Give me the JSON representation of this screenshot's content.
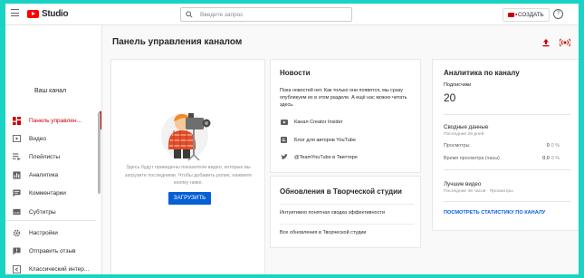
{
  "topbar": {
    "logo_text": "Studio",
    "search_placeholder": "Введите запрос",
    "create_label": "СОЗДАТЬ",
    "help_glyph": "?"
  },
  "sidebar": {
    "channel_label": "Ваш канал",
    "items": [
      {
        "label": "Панель управлен...",
        "icon": "dashboard-icon",
        "active": true
      },
      {
        "label": "Видео",
        "icon": "video-icon"
      },
      {
        "label": "Плейлисты",
        "icon": "playlist-icon"
      },
      {
        "label": "Аналитика",
        "icon": "analytics-icon"
      },
      {
        "label": "Комментарии",
        "icon": "comments-icon"
      },
      {
        "label": "Субтитры",
        "icon": "subtitles-icon"
      },
      {
        "label": "Настройки",
        "icon": "gear-icon"
      },
      {
        "label": "Отправить отзыв",
        "icon": "feedback-icon"
      },
      {
        "label": "Классический интер...",
        "icon": "classic-icon"
      }
    ]
  },
  "main": {
    "title": "Панель управления каналом",
    "upload_card": {
      "text": "Здесь будут приведены показатели видео, которые вы загрузите последними. Чтобы добавить ролик, нажмите кнопку ниже.",
      "button": "ЗАГРУЗИТЬ"
    },
    "news": {
      "title": "Новости",
      "text": "Пока новостей нет. Как только они появятся, мы сразу опубликуем их в этом разделе. А ещё нас можно читать здесь.",
      "links": [
        {
          "label": "Канал Creator Insider",
          "icon": "youtube-icon"
        },
        {
          "label": "Блог для авторов YouTube",
          "icon": "blogger-icon"
        },
        {
          "label": "@TeamYouTube в Твиттере",
          "icon": "twitter-icon"
        }
      ]
    },
    "updates": {
      "title": "Обновления в Творческой студии",
      "items": [
        "Интуитивно понятная сводка эффективности",
        "Все обновления в Творческой студии"
      ]
    },
    "analytics": {
      "title": "Аналитика по каналу",
      "subscribers_label": "Подписчики",
      "subscribers_value": "20",
      "summary_title": "Сводные данные",
      "summary_period": "Последние 28 дней",
      "rows": [
        {
          "label": "Просмотры",
          "value": "0",
          "pct": "0 %"
        },
        {
          "label": "Время просмотра (часы)",
          "value": "0.0",
          "pct": "0 %"
        }
      ],
      "top_title": "Лучшие видео",
      "top_period": "Последние 48 часов · Просмотры",
      "link": "ПОСМОТРЕТЬ СТАТИСТИКУ ПО КАНАЛУ"
    }
  }
}
